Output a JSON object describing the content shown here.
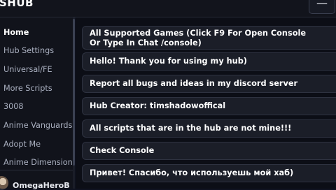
{
  "app": {
    "title": "SHUB",
    "minimize_label": "—"
  },
  "sidebar": {
    "items": [
      {
        "label": "Home",
        "active": true
      },
      {
        "label": "Hub Settings"
      },
      {
        "label": "Universal/FE"
      },
      {
        "label": "More Scripts"
      },
      {
        "label": "3008"
      },
      {
        "label": "Anime Vanguards"
      },
      {
        "label": "Adopt Me"
      },
      {
        "label": "Anime Dimension"
      }
    ],
    "profile": {
      "username": "OmegaHeroBr"
    }
  },
  "main": {
    "cards": [
      {
        "text": "All Supported Games (Click F9 For Open Console\nOr Type In Chat /console)"
      },
      {
        "text": "Hello! Thank you for using my hub)"
      },
      {
        "text": "Report all bugs and ideas in my discord server"
      },
      {
        "text": "Hub Creator: timshadowoffical"
      },
      {
        "text": "All scripts that are in the hub are not mine!!!"
      },
      {
        "text": "Check Console"
      },
      {
        "text": "Привет! Спасибо, что используешь мой хаб)"
      }
    ]
  },
  "colors": {
    "background": "#0f1220",
    "card": "#1b1e28",
    "text": "#ffffff",
    "muted_text": "#aab0c0"
  }
}
